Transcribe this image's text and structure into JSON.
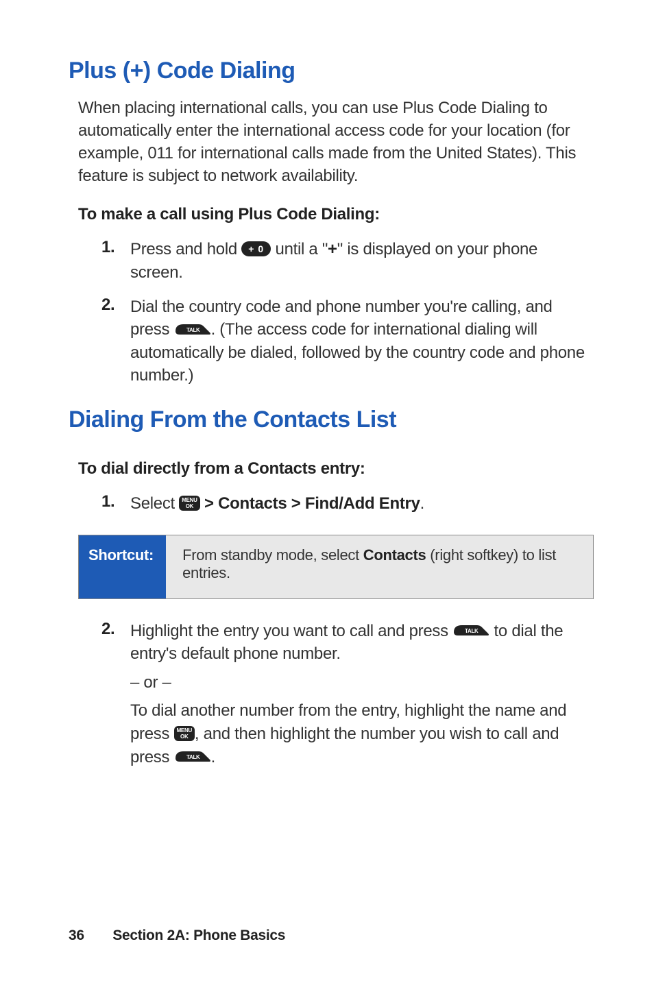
{
  "section1": {
    "title": "Plus (+) Code Dialing",
    "intro": "When placing international calls, you can use Plus Code Dialing to automatically enter the international access code for your location (for example, 011 for international calls made from the United States). This feature is subject to network availability.",
    "subhead": "To make a call using Plus Code Dialing:",
    "steps": {
      "n1": "1.",
      "s1a": "Press and hold ",
      "s1b": " until a \"",
      "s1c": "+",
      "s1d": "\" is displayed on your phone screen.",
      "n2": "2.",
      "s2a": "Dial the country code and phone number you're calling, and press ",
      "s2b": ". (The access code for international dialing will automatically be dialed, followed by the country code and phone number.)"
    }
  },
  "section2": {
    "title": "Dialing From the Contacts List",
    "subhead": "To dial directly from a Contacts entry:",
    "steps": {
      "n1": "1.",
      "s1a": "Select ",
      "s1b": " > Contacts > Find/Add Entry",
      "s1c": ".",
      "n2": "2.",
      "s2a": "Highlight the entry you want to call and press ",
      "s2b": " to dial the entry's default phone number.",
      "or": "– or –",
      "s2c": "To dial another number from the entry, highlight the name and press ",
      "s2d": ", and then highlight the number you wish to call and press ",
      "s2e": "."
    }
  },
  "shortcut": {
    "label": "Shortcut:",
    "text_a": "From standby mode, select ",
    "text_b": "Contacts",
    "text_c": " (right softkey) to list entries."
  },
  "keys": {
    "plus_zero": "+ 0",
    "talk": "TALK",
    "menu_l1": "MENU",
    "menu_l2": "OK"
  },
  "footer": {
    "page": "36",
    "section": "Section 2A: Phone Basics"
  }
}
